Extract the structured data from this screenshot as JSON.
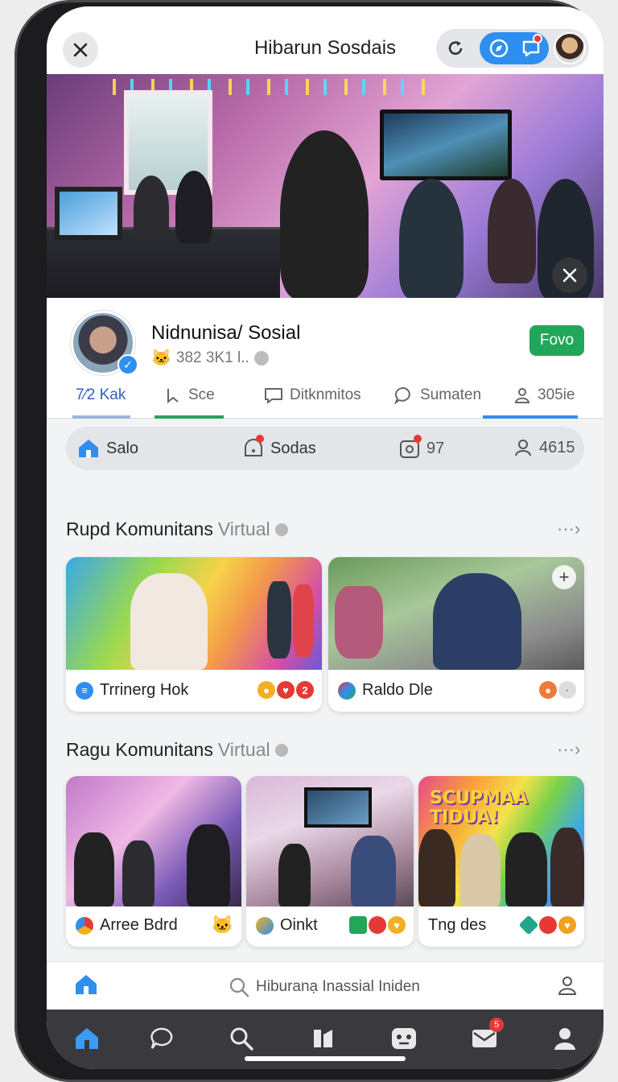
{
  "header": {
    "title": "Hibarun Sosdais"
  },
  "colors": {
    "accent": "#2f8ff0",
    "follow": "#21a65a",
    "badge": "#e53935",
    "nav_bg": "#3a3a3e"
  },
  "profile": {
    "name": "Nidnunisa/ Sosial",
    "subtitle": "382 3K1 l..",
    "follow_label": "Fovo"
  },
  "tabs": [
    {
      "label": "7⁄2 Kak"
    },
    {
      "label": "Sce"
    },
    {
      "label": "Ditknmitos"
    },
    {
      "label": "Sumaten"
    },
    {
      "label": "305ie"
    }
  ],
  "quick": [
    {
      "label": "Salo"
    },
    {
      "label": "Sodas"
    },
    {
      "label": "97"
    },
    {
      "label": "4615"
    }
  ],
  "sections": [
    {
      "title_main": "Rupd Komunitans",
      "title_muted": "Virtual",
      "more": "···›",
      "cards": [
        {
          "label": "Trrinerg Hok",
          "badge": "2"
        },
        {
          "label": "Raldo Dle"
        }
      ]
    },
    {
      "title_main": "Ragu Komunitans",
      "title_muted": "Virtual",
      "more": "···›",
      "cards": [
        {
          "label": "Arree Bdrd"
        },
        {
          "label": "Oinkt"
        },
        {
          "label": "Tng des",
          "banner": "SCUPMAA TIDUA!"
        }
      ]
    }
  ],
  "search": {
    "placeholder": "Hiburanạ Inassial Iniden"
  },
  "nav": {
    "mail_badge": "5"
  },
  "icons": [
    "close-icon",
    "reload-icon",
    "compass-icon",
    "chat-icon",
    "avatar",
    "home-icon",
    "bookmark-icon",
    "chat-bubble-icon",
    "user-icon",
    "search-icon",
    "camera-icon",
    "grid-icon",
    "game-icon",
    "mail-icon",
    "plus-icon"
  ]
}
